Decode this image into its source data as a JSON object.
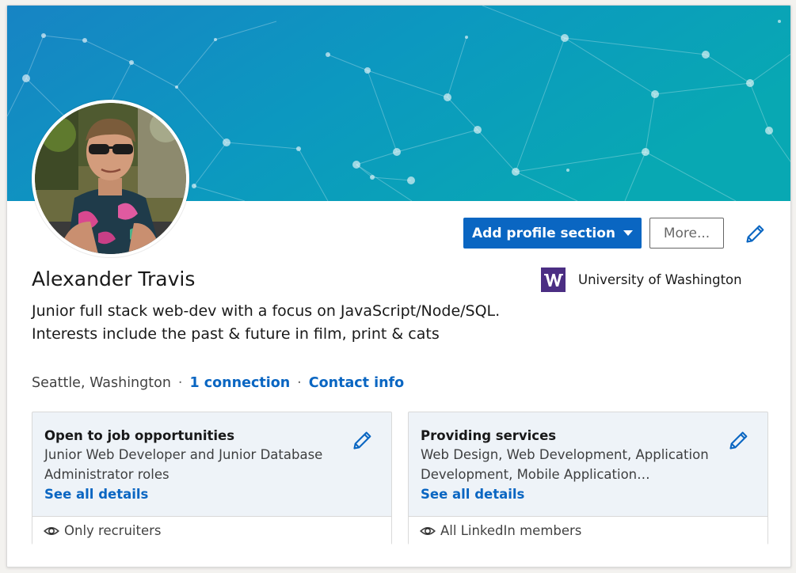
{
  "profile": {
    "name": "Alexander Travis",
    "headline": "Junior full stack web-dev with a focus on JavaScript/Node/SQL. Interests include the past & future in film, print & cats",
    "location": "Seattle, Washington",
    "connections_link": "1 connection",
    "contact_link": "Contact info",
    "separator": "·"
  },
  "actions": {
    "add_section_label": "Add profile section",
    "more_label": "More...",
    "edit_icon": "pencil-icon"
  },
  "education": {
    "school_name": "University of Washington",
    "logo_letter": "W",
    "logo_color": "#4b2e83"
  },
  "cards": [
    {
      "title": "Open to job opportunities",
      "text": "Junior Web Developer and Junior Database Administrator roles",
      "link": "See all details",
      "visibility": "Only recruiters",
      "visibility_icon": "eye-icon"
    },
    {
      "title": "Providing services",
      "text": "Web Design, Web Development, Application Development, Mobile Application Development, Web Applications",
      "link": "See all details",
      "visibility": "All LinkedIn members",
      "visibility_icon": "eye-icon"
    }
  ],
  "colors": {
    "accent": "#0a66c2",
    "banner_start": "#1687c4",
    "banner_end": "#0aa6b3"
  }
}
